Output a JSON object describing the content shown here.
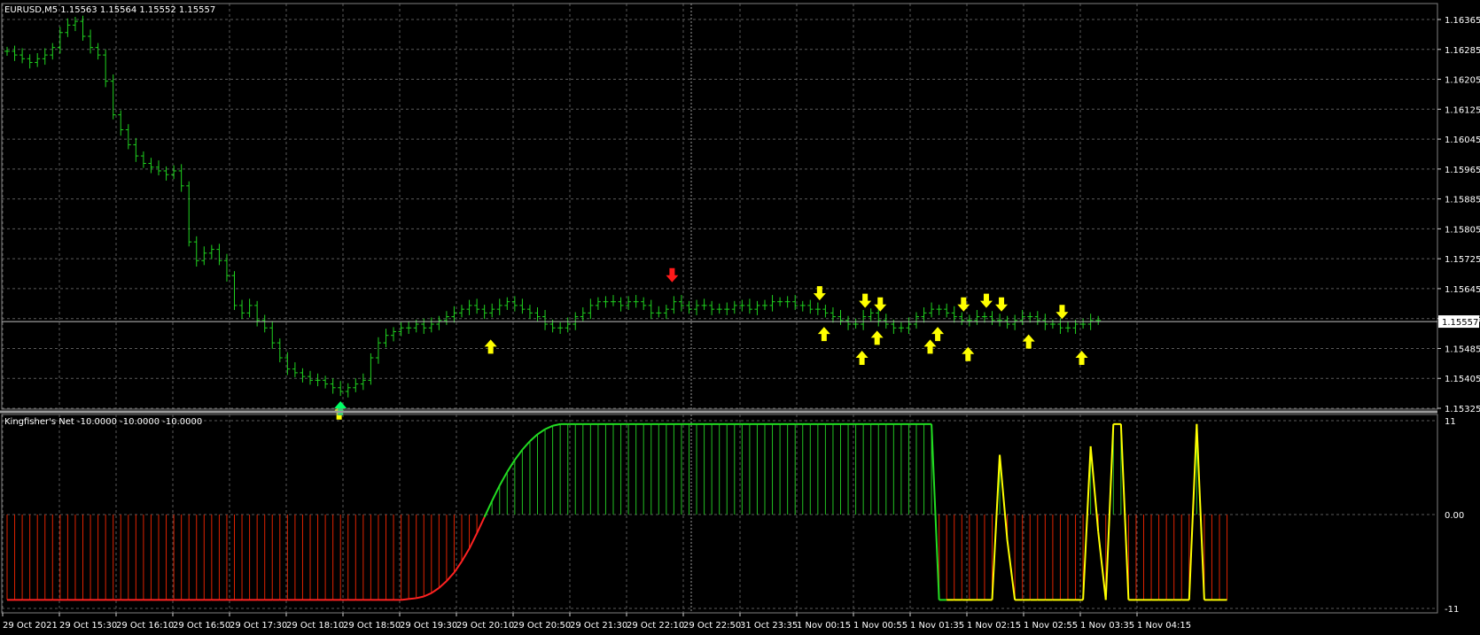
{
  "window": {
    "symbol_info": "EURUSD,M5  1.15563 1.15564 1.15552 1.15557",
    "indicator_info": "Kingfisher's Net -10.0000 -10.0000 -10.0000"
  },
  "colors": {
    "background": "#000000",
    "grid": "#5a5a5a",
    "bar": "#1fd31f",
    "price_line": "#c0c0c0",
    "up_arrow": "#ffff00",
    "down_arrow": "#ffff00",
    "special_up": "#00ff66",
    "special_down": "#ff1a1a",
    "hist_positive": "#22c022",
    "hist_negative": "#dd2200",
    "signal_line_up": "#22dd22",
    "signal_line_down": "#ff2222",
    "signal_line_neutral": "#ffff00"
  },
  "price_axis": {
    "labels": [
      "1.16365",
      "1.16285",
      "1.16205",
      "1.16125",
      "1.16045",
      "1.15965",
      "1.15885",
      "1.15805",
      "1.15725",
      "1.15645",
      "1.15565",
      "1.15485",
      "1.15405",
      "1.15325"
    ],
    "current_price": "1.15557"
  },
  "indicator_axis": {
    "labels": [
      "11",
      "0.00",
      "-11"
    ]
  },
  "time_axis": {
    "labels": [
      "29 Oct 2021",
      "29 Oct 15:30",
      "29 Oct 16:10",
      "29 Oct 16:50",
      "29 Oct 17:30",
      "29 Oct 18:10",
      "29 Oct 18:50",
      "29 Oct 19:30",
      "29 Oct 20:10",
      "29 Oct 20:50",
      "29 Oct 21:30",
      "29 Oct 22:10",
      "29 Oct 22:50",
      "31 Oct 23:35",
      "1 Nov 00:15",
      "1 Nov 00:55",
      "1 Nov 01:35",
      "1 Nov 02:15",
      "1 Nov 02:55",
      "1 Nov 03:35",
      "1 Nov 04:15"
    ]
  },
  "chart_data": [
    {
      "type": "ohlc",
      "symbol": "EURUSD",
      "timeframe": "M5",
      "title": "EURUSD,M5  1.15563 1.15564 1.15552 1.15557",
      "ylim": [
        1.15325,
        1.16405
      ],
      "current_price": 1.15557,
      "close_values": [
        1.1628,
        1.1627,
        1.1626,
        1.1625,
        1.1626,
        1.1627,
        1.1629,
        1.1633,
        1.1635,
        1.1636,
        1.1632,
        1.1629,
        1.1627,
        1.162,
        1.1611,
        1.1607,
        1.1603,
        1.16,
        1.1598,
        1.1597,
        1.1596,
        1.1595,
        1.1596,
        1.1592,
        1.1577,
        1.1572,
        1.1574,
        1.1575,
        1.1572,
        1.1568,
        1.156,
        1.1558,
        1.156,
        1.1556,
        1.1554,
        1.155,
        1.1546,
        1.1543,
        1.1542,
        1.1541,
        1.154,
        1.154,
        1.1539,
        1.1538,
        1.1537,
        1.1538,
        1.1539,
        1.154,
        1.1546,
        1.155,
        1.1552,
        1.1553,
        1.1554,
        1.1554,
        1.1555,
        1.1554,
        1.1555,
        1.1556,
        1.1557,
        1.1558,
        1.1559,
        1.156,
        1.1559,
        1.1558,
        1.1559,
        1.156,
        1.1561,
        1.156,
        1.1559,
        1.1558,
        1.1557,
        1.1555,
        1.1554,
        1.1554,
        1.1555,
        1.1557,
        1.1558,
        1.156,
        1.1561,
        1.1561,
        1.1561,
        1.156,
        1.1561,
        1.1561,
        1.156,
        1.1558,
        1.1558,
        1.1559,
        1.1561,
        1.156,
        1.1559,
        1.156,
        1.156,
        1.1559,
        1.1559,
        1.1559,
        1.156,
        1.156,
        1.1559,
        1.156,
        1.156,
        1.1561,
        1.1561,
        1.1561,
        1.156,
        1.156,
        1.1559,
        1.1559,
        1.1558,
        1.1557,
        1.1556,
        1.1555,
        1.1555,
        1.1557,
        1.1558,
        1.1556,
        1.1555,
        1.1554,
        1.1554,
        1.1555,
        1.1557,
        1.1558,
        1.1559,
        1.1559,
        1.1558,
        1.1557,
        1.1556,
        1.1556,
        1.1557,
        1.1557,
        1.1556,
        1.1556,
        1.1555,
        1.1556,
        1.1557,
        1.1557,
        1.1556,
        1.1555,
        1.1555,
        1.1554,
        1.1554,
        1.1555,
        1.1555,
        1.1556,
        1.1556
      ],
      "up_arrows_index": [
        43,
        63,
        107,
        112,
        114,
        121,
        122,
        126,
        134,
        141
      ],
      "down_arrows_index": [
        107,
        113,
        115,
        126,
        129,
        131,
        139
      ],
      "special_up_index": [
        44
      ],
      "special_down_index": [
        88
      ]
    },
    {
      "type": "histogram",
      "title": "Kingfisher's Net -10.0000 -10.0000 -10.0000",
      "ylim": [
        -11,
        11
      ],
      "values": [
        -10,
        -10,
        -10,
        -10,
        -10,
        -10,
        -10,
        -10,
        -10,
        -10,
        -10,
        -10,
        -10,
        -10,
        -10,
        -10,
        -10,
        -10,
        -10,
        -10,
        -10,
        -10,
        -10,
        -10,
        -10,
        -10,
        -10,
        -10,
        -10,
        -10,
        -10,
        -10,
        -10,
        -10,
        -10,
        -10,
        -10,
        -10,
        -10,
        -10,
        -10,
        -10,
        -10,
        -10,
        -10,
        -10,
        -10,
        -10,
        -10,
        -10,
        -10,
        -10,
        -10,
        -9.9,
        -9.8,
        -9.6,
        -9.2,
        -8.6,
        -7.8,
        -6.8,
        -5.5,
        -4,
        -2.2,
        -0.3,
        1.6,
        3.4,
        5,
        6.4,
        7.6,
        8.6,
        9.4,
        10,
        10.4,
        10.6,
        10.6,
        10.6,
        10.6,
        10.6,
        10.6,
        10.6,
        10.6,
        10.6,
        10.6,
        10.6,
        10.6,
        10.6,
        10.6,
        10.6,
        10.6,
        10.6,
        10.6,
        10.6,
        10.6,
        10.6,
        10.6,
        10.6,
        10.6,
        10.6,
        10.6,
        10.6,
        10.6,
        10.6,
        10.6,
        10.6,
        10.6,
        10.6,
        10.6,
        10.6,
        10.6,
        10.6,
        10.6,
        10.6,
        10.6,
        10.6,
        10.6,
        10.6,
        10.6,
        10.6,
        10.6,
        10.6,
        10.6,
        10.6,
        10.6,
        -10,
        -10,
        -10,
        -10,
        -10,
        -10,
        -10,
        -10,
        7,
        -3,
        -10,
        -10,
        -10,
        -10,
        -10,
        -10,
        -10,
        -10,
        -10,
        -10,
        8,
        -2,
        -10,
        10.6,
        10.6,
        -10,
        -10,
        -10,
        -10,
        -10,
        -10,
        -10,
        -10,
        -10,
        10.6,
        -10,
        -10,
        -10,
        -10
      ]
    }
  ]
}
